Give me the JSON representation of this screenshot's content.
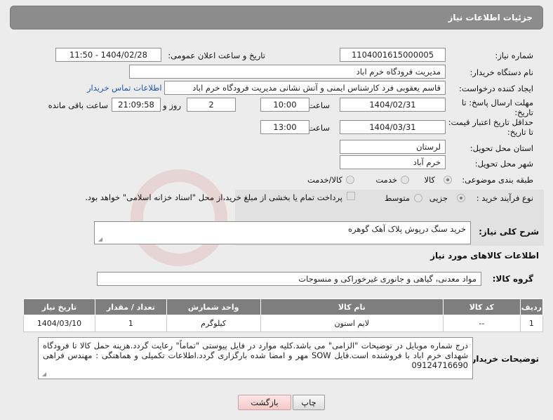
{
  "header": {
    "title": "جزئیات اطلاعات نیاز"
  },
  "fields": {
    "need_number_label": "شماره نیاز:",
    "need_number": "1104001615000005",
    "announce_label": "تاریخ و ساعت اعلان عمومی:",
    "announce_value": "1404/02/28 - 11:50",
    "buyer_org_label": "نام دستگاه خریدار:",
    "buyer_org": "مدیریت فرودگاه خرم اباد",
    "creator_label": "ایجاد کننده درخواست:",
    "creator": "قاسم یعقوبی فرد کارشناس ایمنی و آتش نشانی مدیریت فرودگاه خرم اباد",
    "contact_link": "اطلاعات تماس خریدار",
    "reply_deadline_label_1": "مهلت ارسال پاسخ: تا",
    "reply_deadline_label_2": "تاریخ:",
    "reply_date": "1404/02/31",
    "time_label": "ساعت",
    "reply_time": "10:00",
    "days_value": "2",
    "days_label": "روز و",
    "remaining_time": "21:09:58",
    "remaining_label": "ساعت باقی مانده",
    "price_validity_label_1": "حداقل تاریخ اعتبار قیمت:",
    "price_validity_label_2": "تا تاریخ:",
    "price_date": "1404/03/31",
    "price_time": "13:00",
    "province_label": "استان محل تحویل:",
    "province": "لرستان",
    "city_label": "شهر محل تحویل:",
    "city": "خرم آباد",
    "category_label": "طبقه بندی موضوعی:",
    "category_options": [
      "کالا",
      "خدمت",
      "کالا/خدمت"
    ],
    "process_label": "نوع فرآیند خرید :",
    "process_options": [
      "جزیی",
      "متوسط"
    ],
    "payment_note": "پرداخت تمام یا بخشی از مبلغ خرید،از محل \"اسناد خزانه اسلامی\" خواهد بود."
  },
  "description": {
    "label": "شرح کلی نیاز:",
    "value": "خرید سنگ درپوش پلاک آهک گوهره"
  },
  "goods_section": {
    "title": "اطلاعات کالاهای مورد نیاز",
    "group_label": "گروه کالا:",
    "group_value": "مواد معدنی، گیاهی و جانوری غیرخوراکی و منسوجات"
  },
  "table": {
    "headers": [
      "ردیف",
      "کد کالا",
      "نام کالا",
      "واحد شمارش",
      "تعداد / مقدار",
      "تاریخ نیاز"
    ],
    "rows": [
      [
        "1",
        "--",
        "لایم استون",
        "کیلوگرم",
        "1",
        "1404/03/10"
      ]
    ]
  },
  "buyer_notes": {
    "label": "توضیحات خریدار:",
    "value": "درج شماره موبایل در توضیحات \"الزامی\" می باشد.کلیه موارد در فایل پیوستی \"تماماً\" رعایت گردد.هزینه حمل کالا تا فرودگاه شهدای خرم اباد با فروشنده است.فایل SOW مهر و امضا شده بارگزاری گردد.اطلاعات تکمیلی و هماهنگی : مهندس فراهی 09124716690"
  },
  "buttons": {
    "print": "چاپ",
    "back": "بازگشت"
  },
  "colors": {
    "header_bg": "#8c8c8c",
    "link": "#1a56b8",
    "back_button": "#f3c9c9"
  }
}
